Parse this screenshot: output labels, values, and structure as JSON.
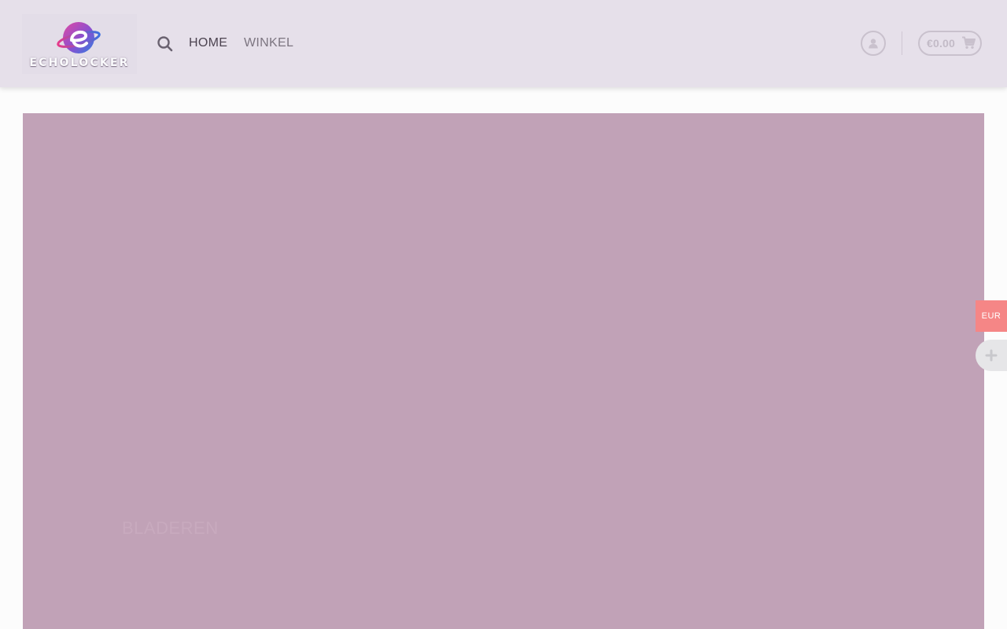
{
  "header": {
    "logo_text": "ECHOLOCKER",
    "nav": {
      "home": "HOME",
      "shop": "WINKEL"
    },
    "cart_total": "€0.00"
  },
  "hero": {
    "link_label": "BLADEREN",
    "background_color": "#c1a2b7"
  },
  "side_widget": {
    "currency": "EUR"
  },
  "colors": {
    "header_bg": "#e6e0ea",
    "currency_tab": "#f58686"
  },
  "icons": [
    "search-icon",
    "user-icon",
    "cart-icon",
    "plus-icon"
  ]
}
